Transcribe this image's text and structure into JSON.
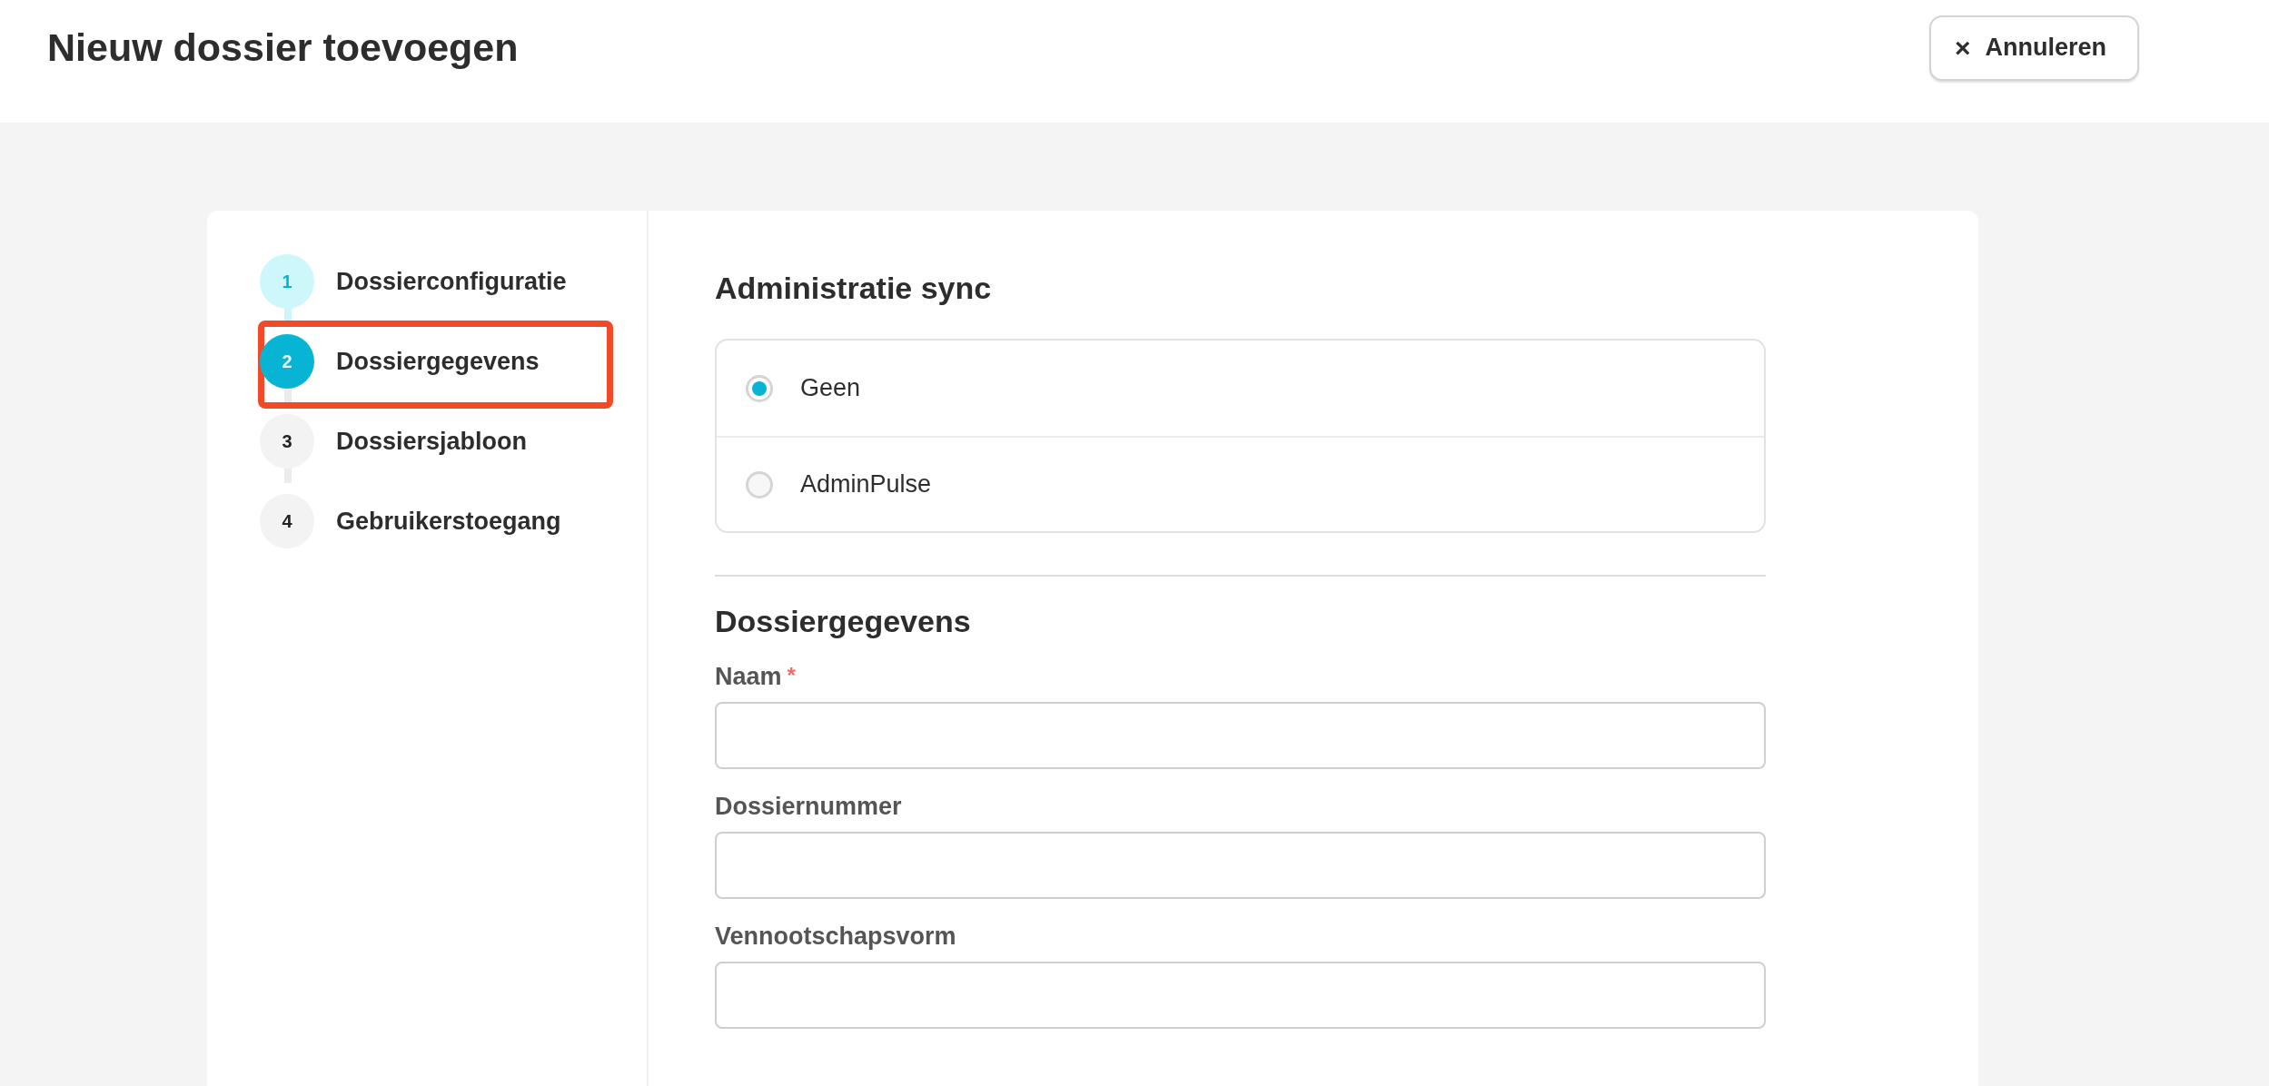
{
  "header": {
    "title": "Nieuw dossier toevoegen",
    "cancel_button": {
      "icon": "×",
      "label": "Annuleren"
    }
  },
  "steps": [
    {
      "number": "1",
      "label": "Dossierconfiguratie",
      "completed": true,
      "selected": false,
      "highlighted": false
    },
    {
      "number": "2",
      "label": "Dossiergegevens",
      "completed": false,
      "selected": true,
      "highlighted": true
    },
    {
      "number": "3",
      "label": "Dossiersjabloon",
      "completed": false,
      "selected": false,
      "highlighted": false
    },
    {
      "number": "4",
      "label": "Gebruikerstoegang",
      "completed": false,
      "selected": false,
      "highlighted": false
    }
  ],
  "sync_section": {
    "title": "Administratie sync",
    "options": [
      {
        "label": "Geen",
        "selected": true
      },
      {
        "label": "AdminPulse",
        "selected": false
      }
    ]
  },
  "details_section": {
    "title": "Dossiergegevens",
    "fields": [
      {
        "label": "Naam",
        "required_mark": "*"
      },
      {
        "label": "Dossiernummer"
      },
      {
        "label": "Vennootschapsvorm"
      }
    ]
  }
}
